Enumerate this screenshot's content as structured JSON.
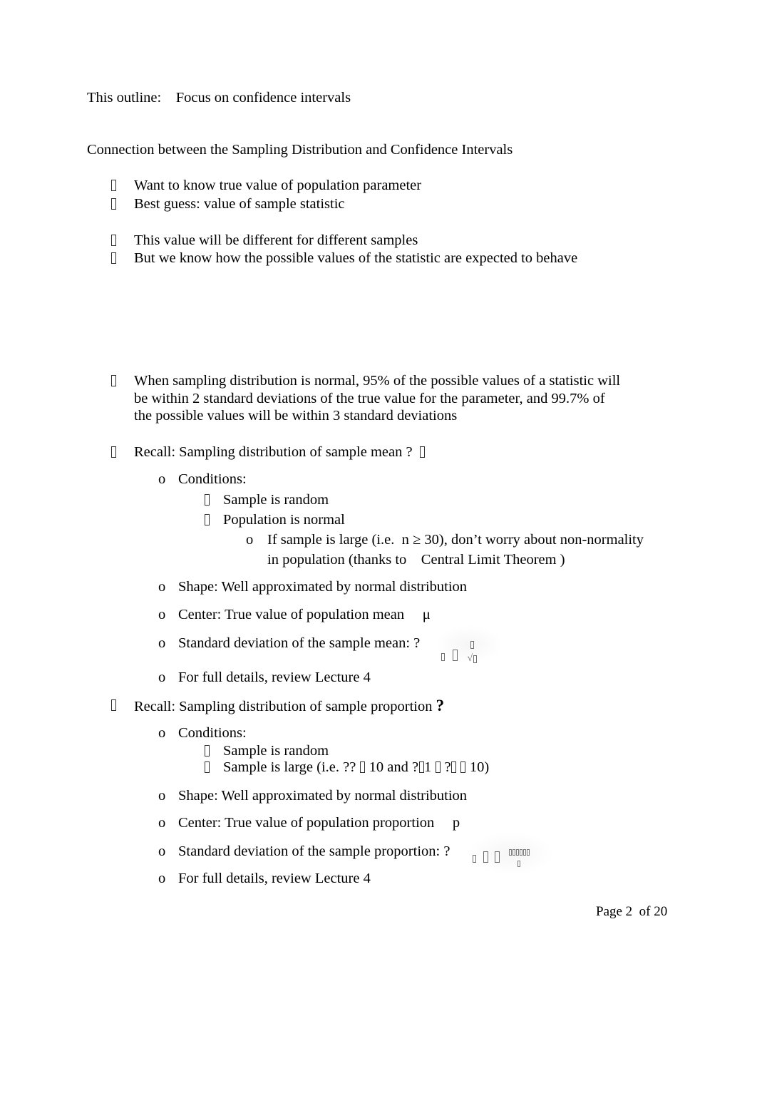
{
  "document": {
    "page_label": "Page 2  of 20",
    "page_number": 2,
    "page_total": 20
  },
  "header": {
    "outline_label": "This outline:",
    "outline_topic": "Focus on confidence intervals",
    "section_title": "Connection between the Sampling Distribution and Confidence Intervals"
  },
  "intro_bullets": [
    {
      "text": "Want to know true value of population parameter"
    },
    {
      "text": "Best guess: value of sample statistic"
    },
    {
      "text": "This value will be different for different samples"
    },
    {
      "text": "But we know how the possible values of the statistic are expected to behave"
    }
  ],
  "normal_rule": {
    "line1": "When sampling distribution is normal, 95% of the possible values of a statistic will",
    "line2": "be within 2 standard deviations of the true value for the parameter, and 99.7% of",
    "line3": "the possible values will be within 3 standard deviations"
  },
  "sample_mean": {
    "heading": "Recall: Sampling distribution of sample mean ?",
    "conditions_label": "Conditions:",
    "conditions": [
      "Sample is random",
      "Population is normal"
    ],
    "clt_note_line1": "If sample is large (i.e.  n ≥ 30), don’t worry about non-normality",
    "clt_note_line2": "in population (thanks to    Central Limit Theorem )",
    "shape": "Shape: Well approximated by normal distribution",
    "center": "Center: True value of population mean",
    "center_symbol": "μ",
    "sd_label": "Standard deviation of the sample mean: ?",
    "details": "For full details, review Lecture 4"
  },
  "sample_proportion": {
    "heading": "Recall: Sampling distribution of sample proportion",
    "heading_symbol": "?",
    "conditions_label": "Conditions:",
    "condition_random": "Sample is random",
    "condition_large_prefix": "Sample is large (i.e. ?? ",
    "condition_large_mid": " 10 and ?",
    "condition_large_mid2": "1 ",
    "condition_large_mid3": " ?",
    "condition_large_suffix": " 10)",
    "shape": "Shape: Well approximated by normal distribution",
    "center": "Center: True value of population proportion",
    "center_symbol": "p",
    "sd_label": "Standard deviation of the sample proportion: ?",
    "details": "For full details, review Lecture 4"
  }
}
